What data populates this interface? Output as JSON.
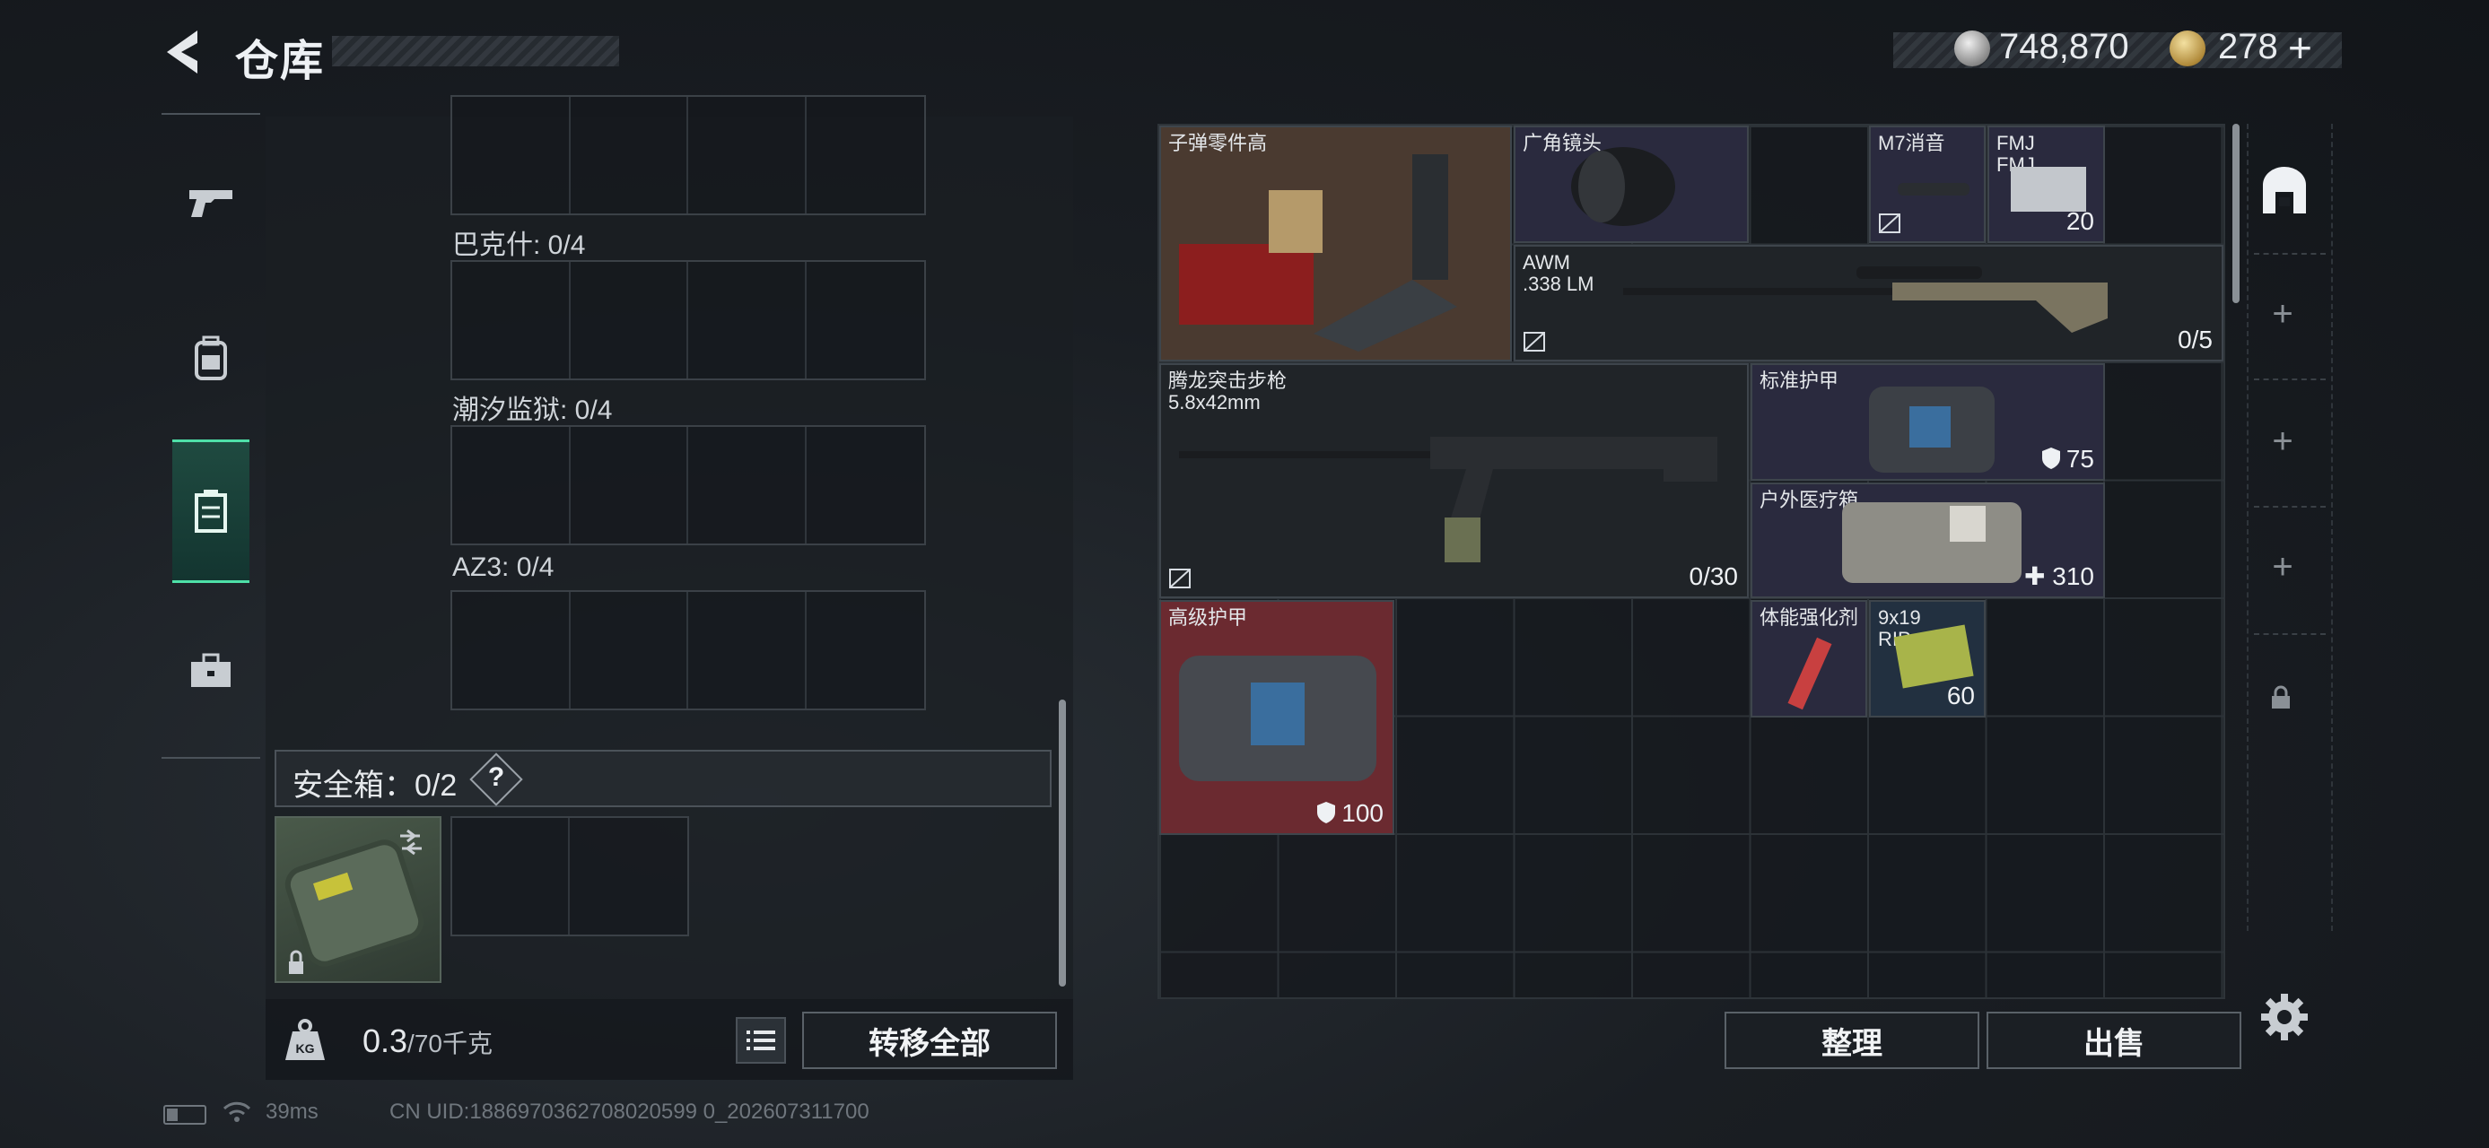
{
  "header": {
    "title": "仓库",
    "currency_silver": "748,870",
    "currency_gold": "278",
    "currency_add": "+"
  },
  "sidebar": {
    "tabs": [
      {
        "name": "weapons",
        "icon": "pistol-icon"
      },
      {
        "name": "backpack",
        "icon": "backpack-icon"
      },
      {
        "name": "storage",
        "icon": "locker-icon",
        "active": true
      },
      {
        "name": "toolbox",
        "icon": "toolbox-icon"
      }
    ]
  },
  "left_panel": {
    "slot_groups": [
      {
        "label": ""
      },
      {
        "label": "巴克什: 0/4"
      },
      {
        "label": "潮汐监狱: 0/4"
      },
      {
        "label": "AZ3: 0/4"
      }
    ],
    "safe_box_label": "安全箱：0/2",
    "help": "?",
    "weight_value": "0.3",
    "weight_max": "/70千克",
    "transfer_all": "转移全部"
  },
  "grid_items": [
    {
      "name": "子弹零件高",
      "count": ""
    },
    {
      "name": "广角镜头",
      "count": ""
    },
    {
      "name": "M7消音",
      "count": ""
    },
    {
      "name": "FMJ\nFMJ",
      "count": "20"
    },
    {
      "name": "AWM\n.338 LM",
      "count": "0/5"
    },
    {
      "name": "腾龙突击步枪\n5.8x42mm",
      "count": "0/30"
    },
    {
      "name": "标准护甲",
      "count": "75"
    },
    {
      "name": "户外医疗箱",
      "count": "310"
    },
    {
      "name": "高级护甲",
      "count": "100"
    },
    {
      "name": "体能强化剂",
      "count": ""
    },
    {
      "name": "9x19\nRIP",
      "count": "60"
    }
  ],
  "buttons": {
    "sort": "整理",
    "sell": "出售"
  },
  "status_bar": {
    "ping": "39ms",
    "uid": "CN UID:1886970362708020599 0_202607311700"
  },
  "colors": {
    "accent": "#4ee0a8",
    "armor_red": "#6b2a30",
    "rare_purple": "#2a2a3e",
    "rare_blue": "#223040",
    "rare_brown": "#4a3a30"
  }
}
